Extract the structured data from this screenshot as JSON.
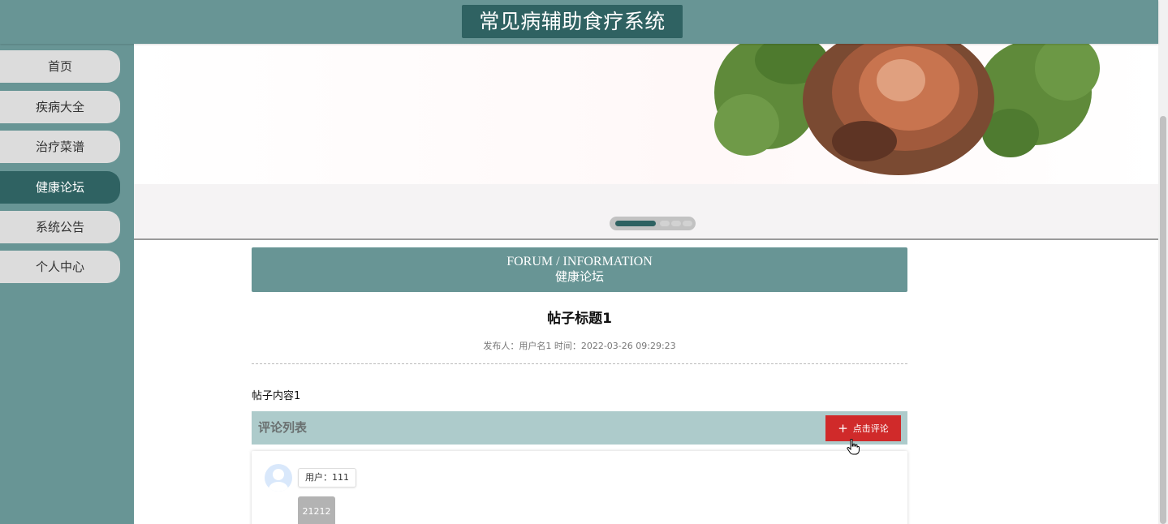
{
  "header": {
    "site_title": "常见病辅助食疗系统"
  },
  "sidebar": {
    "items": [
      {
        "label": "首页",
        "active": false
      },
      {
        "label": "疾病大全",
        "active": false
      },
      {
        "label": "治疗菜谱",
        "active": false
      },
      {
        "label": "健康论坛",
        "active": true
      },
      {
        "label": "系统公告",
        "active": false
      },
      {
        "label": "个人中心",
        "active": false
      }
    ]
  },
  "banner": {
    "slide_count": 4,
    "active_slide": 1
  },
  "section": {
    "title_en": "FORUM / INFORMATION",
    "title_cn": "健康论坛"
  },
  "post": {
    "title": "帖子标题1",
    "meta": "发布人：用户名1 时间：2022-03-26 09:29:23",
    "content": "帖子内容1"
  },
  "comments": {
    "header": "评论列表",
    "add_button": "点击评论",
    "add_icon": "plus-icon",
    "items": [
      {
        "user": "用户：111",
        "text": "21212"
      }
    ]
  },
  "colors": {
    "primary": "#689595",
    "primary_dark": "#2f6262",
    "accent_red": "#d02a2a",
    "comment_bar": "#adcbcb"
  }
}
